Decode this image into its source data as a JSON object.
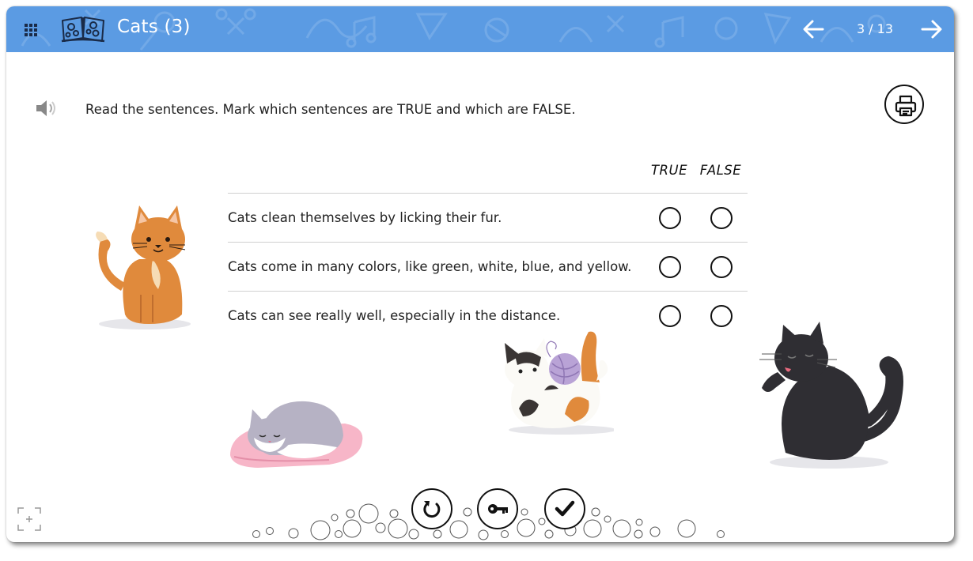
{
  "header": {
    "title": "Cats (3)",
    "page_counter": "3 / 13",
    "accent_color": "#5b9be3",
    "menu_icon": "grid-menu-icon",
    "logo_icon": "open-book-icon"
  },
  "activity": {
    "instruction_parts": {
      "a": "Read the sentences. Mark which sentences are ",
      "b": "TRUE",
      "c": " and which are ",
      "d": "FALSE",
      "e": "."
    },
    "columns": {
      "true_label": "TRUE",
      "false_label": "FALSE"
    },
    "statements": [
      "Cats clean themselves by licking their fur.",
      "Cats come in many colors, like green, white, blue, and yellow.",
      "Cats can see really well, especially in the distance."
    ]
  },
  "icons": {
    "audio": "speaker-icon",
    "print": "printer-icon",
    "reset": "reset-icon",
    "answer_key": "key-icon",
    "check": "check-icon",
    "fullscreen": "fullscreen-icon"
  },
  "illustrations": [
    "orange-sitting-cat",
    "grey-sleeping-cat",
    "calico-cat-with-yarn",
    "black-cat-licking-paw"
  ]
}
